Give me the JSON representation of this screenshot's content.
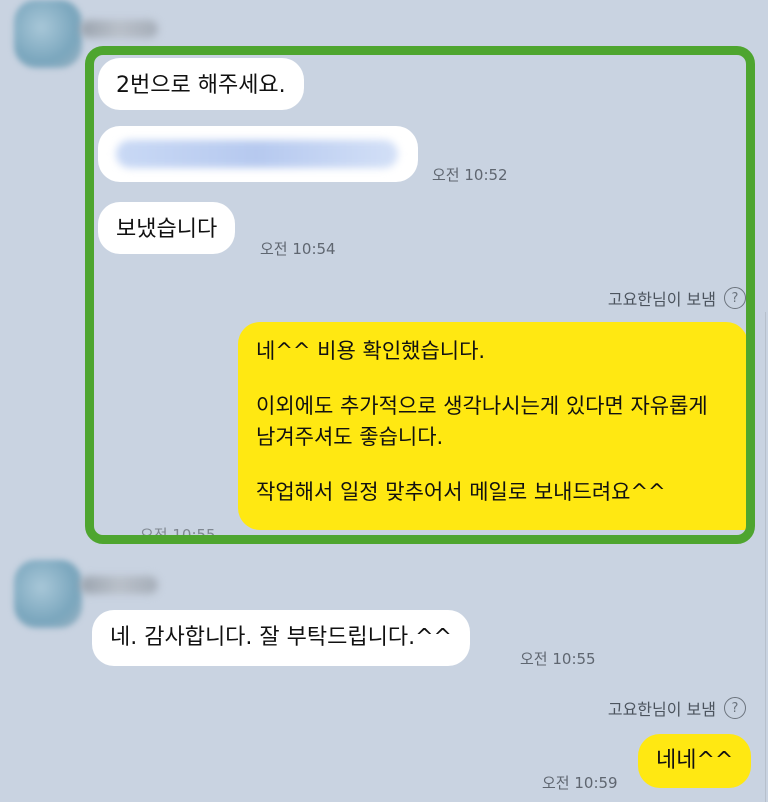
{
  "messages": {
    "m1_text": "2번으로 해주세요.",
    "m3_time": "오전 10:52",
    "m4_text": "보냈습니다",
    "m4_time": "오전 10:54",
    "sent_by_1": "고요한님이 보냄",
    "m5_lines": [
      "네^^ 비용 확인했습니다.",
      "이외에도 추가적으로 생각나시는게 있다면 자유롭게 남겨주셔도 좋습니다.",
      "작업해서 일정 맞추어서 메일로 보내드려요^^"
    ],
    "m5_time": "오전 10:55",
    "m6_text": "네. 감사합니다. 잘 부탁드립니다.^^",
    "m6_time": "오전 10:55",
    "sent_by_2": "고요한님이 보냄",
    "m7_text": "네네^^",
    "m7_time": "오전 10:59"
  },
  "icons": {
    "help": "?"
  },
  "colors": {
    "background": "#c9d3e1",
    "incoming_bubble": "#ffffff",
    "outgoing_bubble": "#ffe812",
    "highlight_border": "#4ea52f"
  }
}
